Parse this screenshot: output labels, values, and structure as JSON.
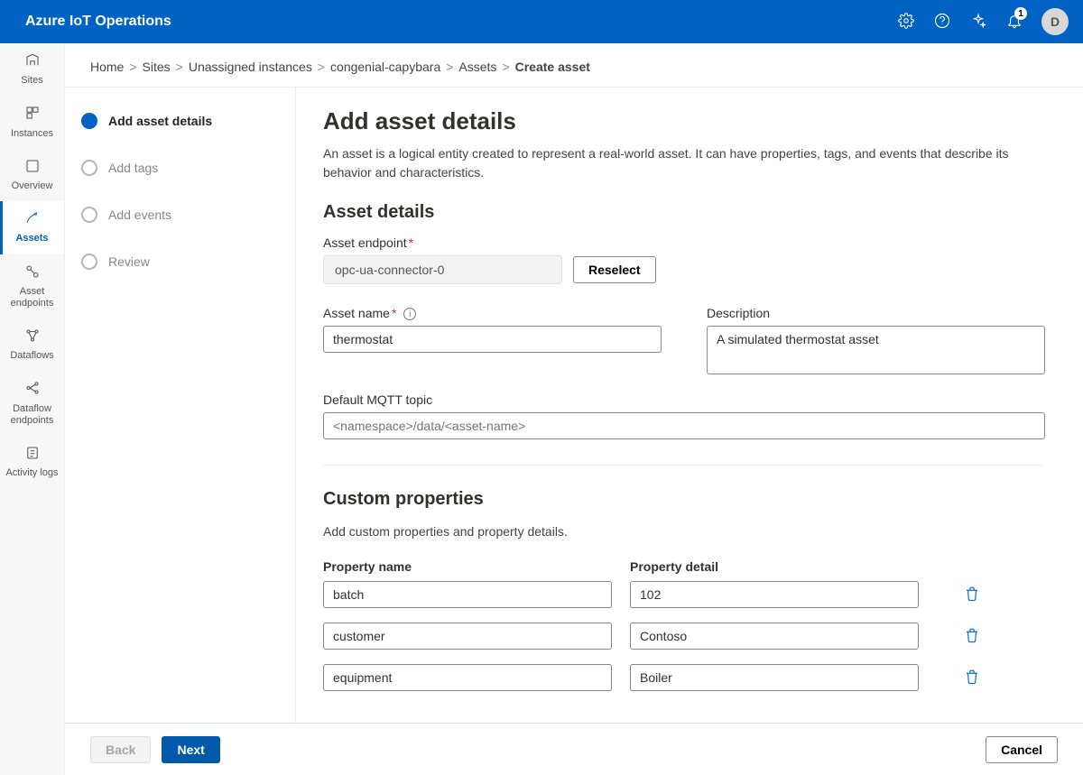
{
  "header": {
    "product_name": "Azure IoT Operations",
    "notification_count": "1",
    "avatar_initial": "D"
  },
  "sidenav": {
    "items": [
      {
        "id": "sites",
        "label": "Sites"
      },
      {
        "id": "instances",
        "label": "Instances"
      },
      {
        "id": "overview",
        "label": "Overview"
      },
      {
        "id": "assets",
        "label": "Assets"
      },
      {
        "id": "asset-endpoints",
        "label": "Asset endpoints"
      },
      {
        "id": "dataflows",
        "label": "Dataflows"
      },
      {
        "id": "dataflow-endpoints",
        "label": "Dataflow endpoints"
      },
      {
        "id": "activity-logs",
        "label": "Activity logs"
      }
    ],
    "active_id": "assets"
  },
  "breadcrumb": {
    "items": [
      "Home",
      "Sites",
      "Unassigned instances",
      "congenial-capybara",
      "Assets",
      "Create asset"
    ]
  },
  "wizard": {
    "steps": [
      {
        "id": "details",
        "label": "Add asset details"
      },
      {
        "id": "tags",
        "label": "Add tags"
      },
      {
        "id": "events",
        "label": "Add events"
      },
      {
        "id": "review",
        "label": "Review"
      }
    ],
    "current_id": "details"
  },
  "form": {
    "title": "Add asset details",
    "intro": "An asset is a logical entity created to represent a real-world asset. It can have properties, tags, and events that describe its behavior and characteristics.",
    "section_details_heading": "Asset details",
    "endpoint_label": "Asset endpoint",
    "endpoint_value": "opc-ua-connector-0",
    "reselect_label": "Reselect",
    "asset_name_label": "Asset name",
    "asset_name_value": "thermostat",
    "description_label": "Description",
    "description_value": "A simulated thermostat asset",
    "mqtt_label": "Default MQTT topic",
    "mqtt_placeholder": "<namespace>/data/<asset-name>",
    "mqtt_value": "",
    "custom_heading": "Custom properties",
    "custom_sub": "Add custom properties and property details.",
    "prop_name_header": "Property name",
    "prop_detail_header": "Property detail",
    "properties": [
      {
        "name": "batch",
        "detail": "102"
      },
      {
        "name": "customer",
        "detail": "Contoso"
      },
      {
        "name": "equipment",
        "detail": "Boiler"
      }
    ]
  },
  "footer": {
    "back": "Back",
    "next": "Next",
    "cancel": "Cancel"
  }
}
